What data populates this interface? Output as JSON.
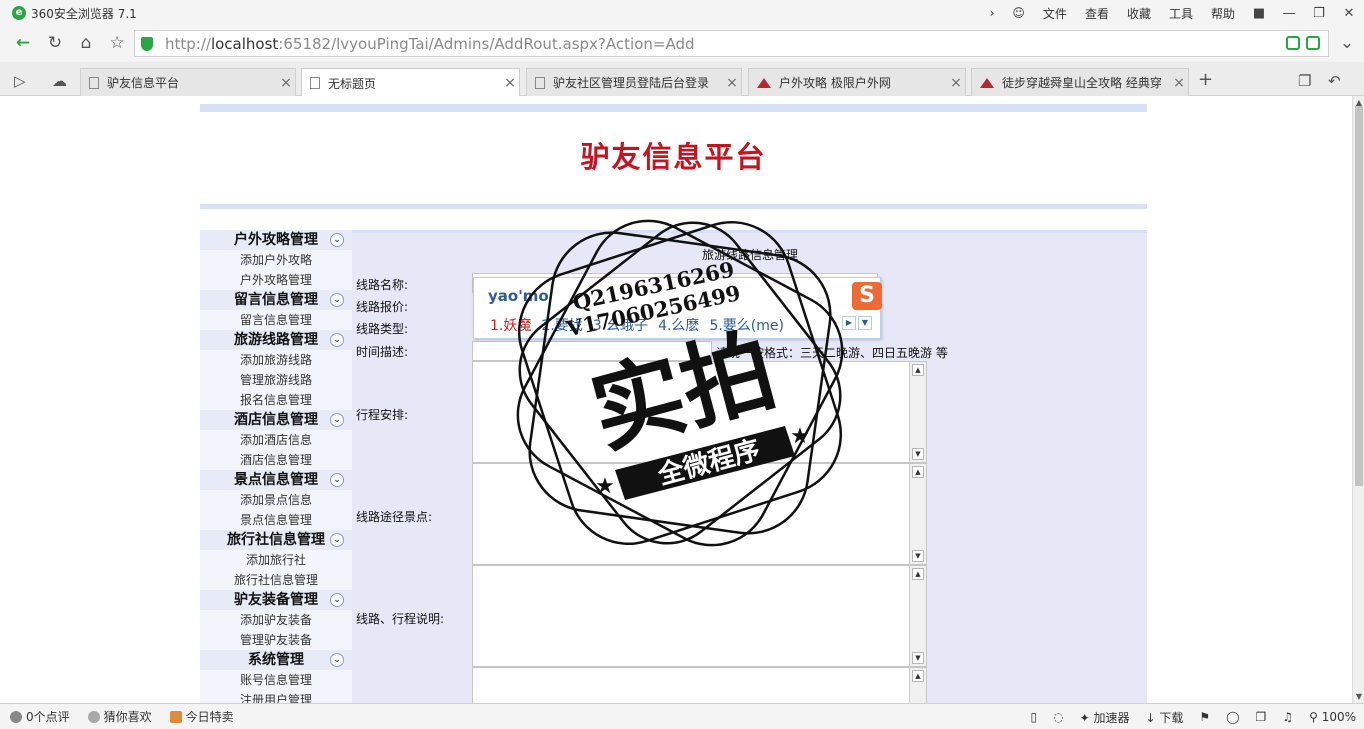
{
  "browser": {
    "title": "360安全浏览器 7.1",
    "menu": [
      "文件",
      "查看",
      "收藏",
      "工具",
      "帮助"
    ],
    "url_host_prefix": "http://",
    "url_host": "localhost",
    "url_rest": ":65182/lvyouPingTai/Admins/AddRout.aspx?Action=Add",
    "tabs": [
      {
        "label": "驴友信息平台",
        "active": false
      },
      {
        "label": "无标题页",
        "active": true
      },
      {
        "label": "驴友社区管理员登陆后台登录",
        "active": false
      },
      {
        "label": "户外攻略 极限户外网",
        "active": false
      },
      {
        "label": "徒步穿越舜皇山全攻略 经典穿",
        "active": false
      }
    ],
    "status": {
      "reviews": "0个点评",
      "guess": "猜你喜欢",
      "deals": "今日特卖",
      "accelerator": "加速器",
      "download": "下载",
      "zoom": "100%"
    }
  },
  "site": {
    "title": "驴友信息平台",
    "sidebar": [
      {
        "heading": "户外攻略管理",
        "items": [
          "添加户外攻略",
          "户外攻略管理"
        ]
      },
      {
        "heading": "留言信息管理",
        "items": [
          "留言信息管理"
        ]
      },
      {
        "heading": "旅游线路管理",
        "items": [
          "添加旅游线路",
          "管理旅游线路",
          "报名信息管理"
        ]
      },
      {
        "heading": "酒店信息管理",
        "items": [
          "添加酒店信息",
          "酒店信息管理"
        ]
      },
      {
        "heading": "景点信息管理",
        "items": [
          "添加景点信息",
          "景点信息管理"
        ]
      },
      {
        "heading": "旅行社信息管理",
        "items": [
          "添加旅行社",
          "旅行社信息管理"
        ]
      },
      {
        "heading": "驴友装备管理",
        "items": [
          "添加驴友装备",
          "管理驴友装备"
        ]
      },
      {
        "heading": "系统管理",
        "items": [
          "账号信息管理",
          "注册用户管理"
        ]
      }
    ],
    "form": {
      "title": "旅游线路信息管理",
      "labels": {
        "name": "线路名称:",
        "price": "线路报价:",
        "type": "线路类型:",
        "time": "时间描述:",
        "schedule": "行程安排:",
        "spots": "线路途径景点:",
        "notes": "线路、行程说明:"
      },
      "time_hint": "请统一按格式：三天二晚游、四日五晚游 等"
    }
  },
  "ime": {
    "composition": "yao'mo",
    "candidates": [
      "1.妖魔",
      "2.要找",
      "3.幺蛾子",
      "4.么麽",
      "5.要么(me)"
    ]
  },
  "watermark": {
    "qq": "Q2196316269",
    "phone": "V17060256499",
    "main": "实拍",
    "sub": "全微程序"
  }
}
